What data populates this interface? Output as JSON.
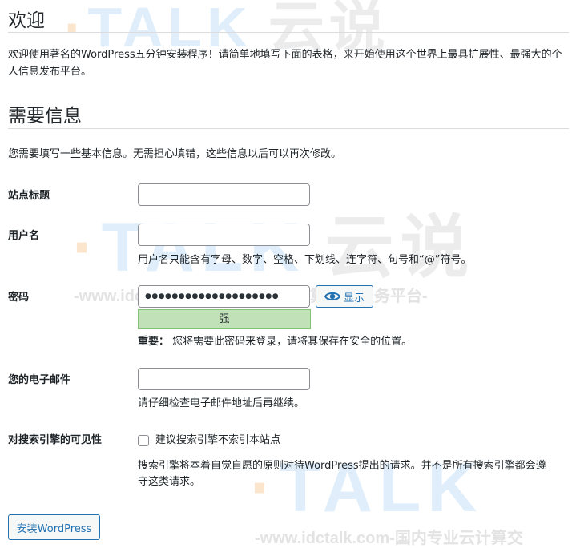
{
  "watermark": {
    "logo_word": "TALK",
    "logo_cn": "云说",
    "tagline": "-www.idctalk.com-国内专业云计算交流服务平台-",
    "tagline_partial": "-www.idctalk.com-国内专业云计算交"
  },
  "welcome": {
    "title": "欢迎",
    "text": "欢迎使用著名的WordPress五分钟安装程序！请简单地填写下面的表格，来开始使用这个世界上最具扩展性、最强大的个人信息发布平台。"
  },
  "info": {
    "title": "需要信息",
    "text": "您需要填写一些基本信息。无需担心填错，这些信息以后可以再次修改。"
  },
  "form": {
    "site_title_label": "站点标题",
    "site_title_value": "",
    "username_label": "用户名",
    "username_value": "",
    "username_hint": "用户名只能含有字母、数字、空格、下划线、连字符、句号和“@”符号。",
    "password_label": "密码",
    "password_mask": "●●●●●●●●●●●●●●●●●●●●",
    "show_button": "显示",
    "strength": "强",
    "important_label": "重要：",
    "important_text": "您将需要此密码来登录，请将其保存在安全的位置。",
    "email_label": "您的电子邮件",
    "email_value": "",
    "email_hint": "请仔细检查电子邮件地址后再继续。",
    "search_label": "对搜索引擎的可见性",
    "search_checkbox_label": "建议搜索引擎不索引本站点",
    "search_hint": "搜索引擎将本着自觉自愿的原则对待WordPress提出的请求。并不是所有搜索引擎都会遵守这类请求。",
    "install_button": "安装WordPress"
  }
}
